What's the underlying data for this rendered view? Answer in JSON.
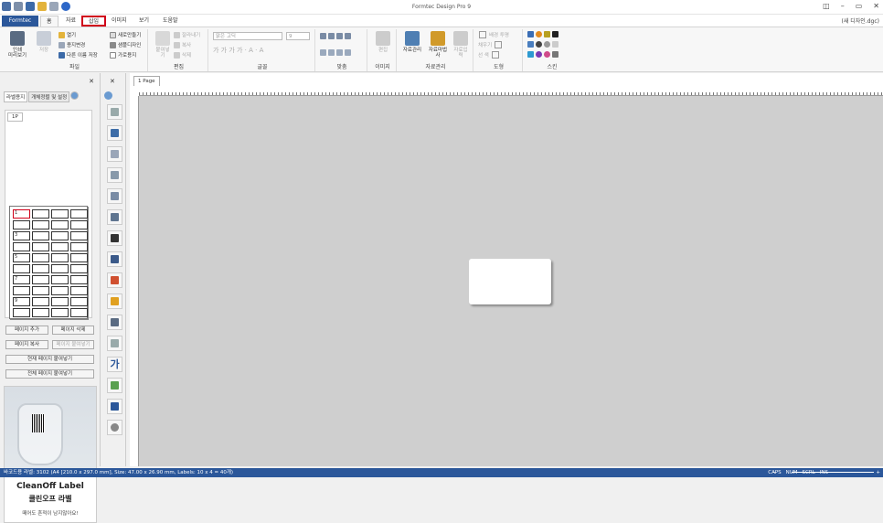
{
  "app": {
    "title": "Formtec Design Pro 9",
    "document": "(새 디자인.dgc)"
  },
  "tabs": [
    "Formtec",
    "홈",
    "자료",
    "삽입",
    "이미지",
    "보기",
    "도움말"
  ],
  "ribbon": {
    "print": "인쇄\n미리보기",
    "save": "저장",
    "file_items": [
      "열기",
      "용지변경",
      "다른 이름 저장"
    ],
    "file_items2": [
      "새로만들기",
      "샘플디자인",
      "가로용지"
    ],
    "paste": "붙여넣기",
    "edit_items": [
      "잘라내기",
      "복사",
      "삭제"
    ],
    "font_name": "맑은 고딕",
    "font_size": "9",
    "image_btn": "편집",
    "data_btns": [
      "자료관리",
      "자료마법사",
      "자료입력"
    ],
    "shape_items": [
      "배경 투명",
      "채우기",
      "선 색"
    ],
    "groups": [
      "파일",
      "편집",
      "글꼴",
      "맞춤",
      "이미지",
      "자료관리",
      "도형",
      "스킨"
    ]
  },
  "left": {
    "tabs": [
      "라벨용지",
      "개체정렬 및 설정"
    ],
    "page_tab": "1P",
    "cells": [
      "1",
      "3",
      "5",
      "7",
      "9"
    ],
    "buttons": [
      "페이지 추가",
      "페이지 삭제",
      "페이지 복사",
      "페이지 붙여넣기",
      "현재 페이지 붙여넣기",
      "전체 페이지 붙여넣기"
    ],
    "ad": {
      "title": "CleanOff Label",
      "subtitle": "클린오프 라벨",
      "desc": "떼어도 흔적이 남지않아요!"
    }
  },
  "page_tab": "1 Page",
  "status": {
    "left": "바코드용 라벨: 3102 (A4 [210.0 x 297.0 mm], Size: 47.00 x 26.90 mm, Labels: 10 x 4 = 40개)",
    "indicators": [
      "CAPS",
      "NUM",
      "SCRL",
      "INS"
    ],
    "zoom_minus": "−",
    "zoom_plus": "+"
  }
}
